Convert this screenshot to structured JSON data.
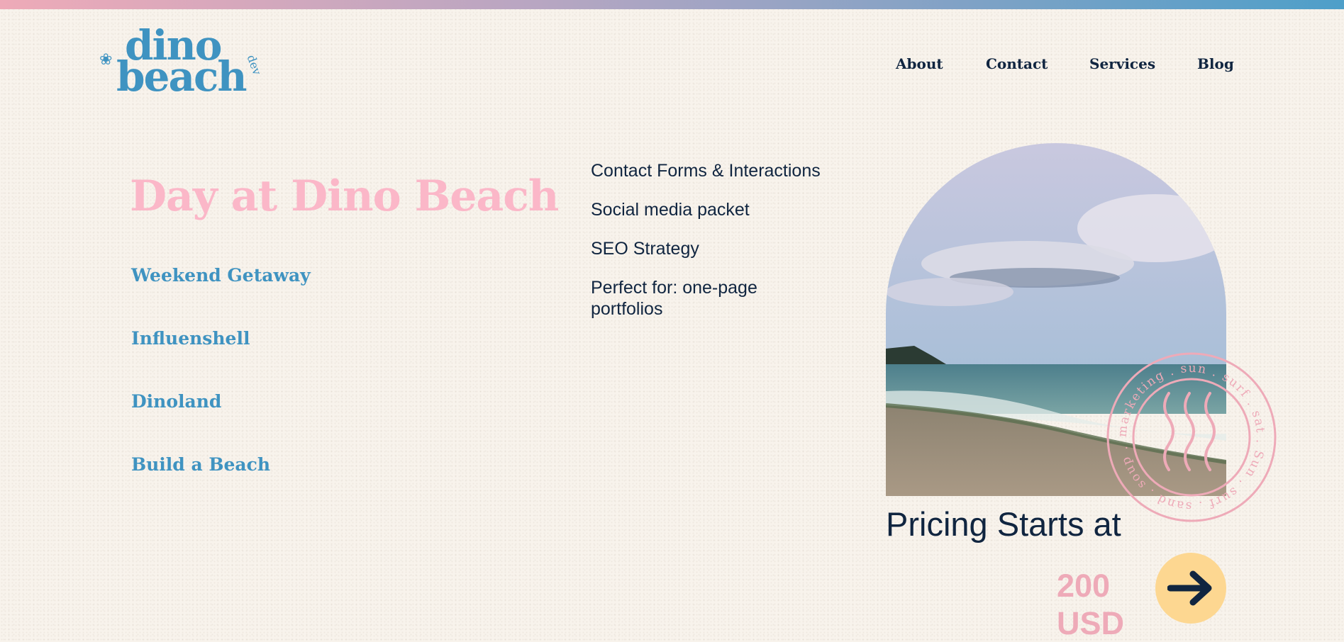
{
  "brand": {
    "logo_line1": "dino",
    "logo_line2": "beach",
    "logo_suffix": "dev",
    "accent": "#3f93c1",
    "pink": "#fbb7c8"
  },
  "nav": {
    "items": [
      "About",
      "Contact",
      "Services",
      "Blog"
    ]
  },
  "hero": {
    "title": "Day at Dino Beach"
  },
  "packages": [
    "Weekend Getaway",
    "Influenshell",
    "Dinoland",
    "Build a Beach"
  ],
  "features": [
    "Contact Forms & Interactions",
    "Social media packet",
    "SEO Strategy",
    "Perfect for: one-page portfolios"
  ],
  "stamp": {
    "text": "marketing . sun . surf . sat . Sun . surf . sand . soup . dunk"
  },
  "pricing": {
    "label": "Pricing Starts at",
    "amount": "200",
    "currency": "USD",
    "arrow_icon": "arrow-right-icon",
    "button_color": "#fdd791"
  }
}
